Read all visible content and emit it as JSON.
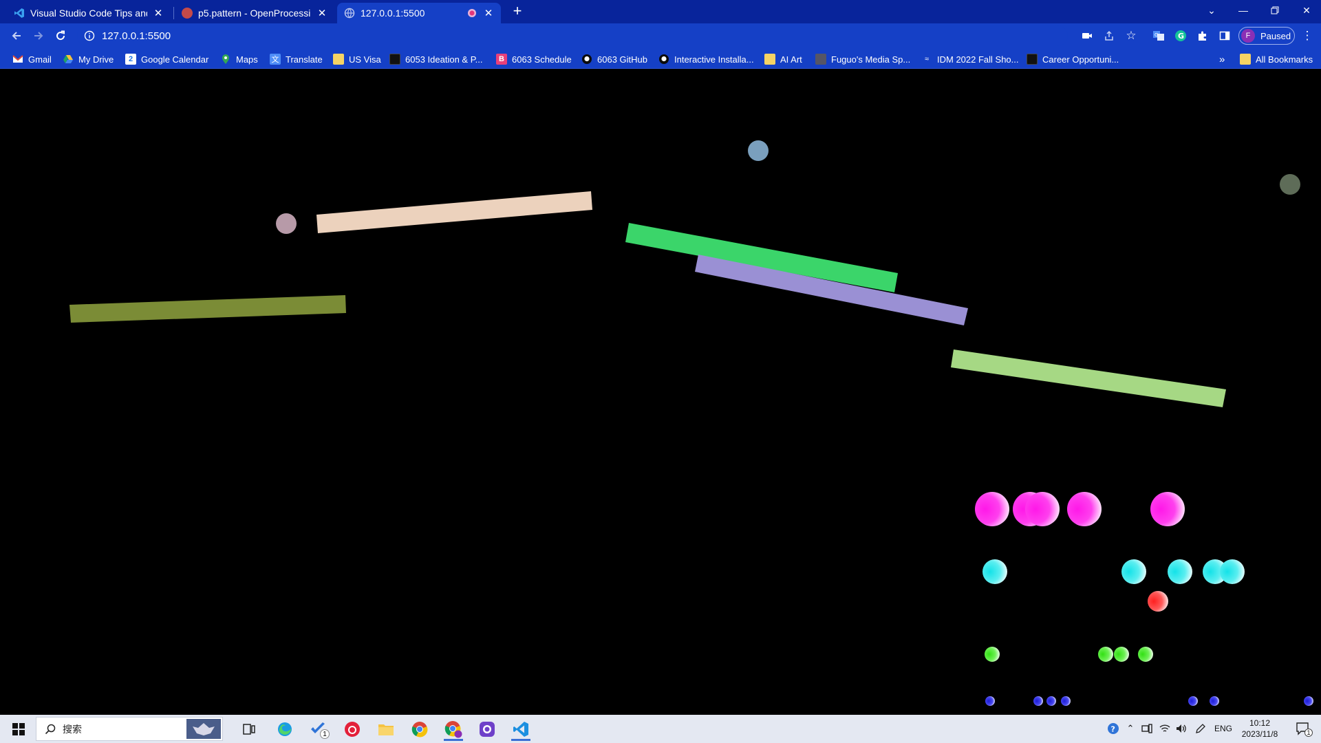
{
  "browser": {
    "tabs": [
      {
        "title": "Visual Studio Code Tips and T",
        "favicon": "vscode-icon",
        "active": false
      },
      {
        "title": "p5.pattern - OpenProcessing",
        "favicon": "openprocessing-icon",
        "active": false
      },
      {
        "title": "127.0.0.1:5500",
        "favicon": "globe-icon",
        "active": true,
        "recording": true
      }
    ],
    "new_tab": "+",
    "address": "127.0.0.1:5500",
    "profile": {
      "initial": "F",
      "status": "Paused"
    },
    "bookmarks": [
      {
        "label": "Gmail",
        "icon": "gmail-icon"
      },
      {
        "label": "My Drive",
        "icon": "drive-icon"
      },
      {
        "label": "Google Calendar",
        "icon": "calendar-icon"
      },
      {
        "label": "Maps",
        "icon": "maps-icon"
      },
      {
        "label": "Translate",
        "icon": "translate-icon"
      },
      {
        "label": "US Visa",
        "icon": "folder-icon"
      },
      {
        "label": "6053 Ideation & P...",
        "icon": "notion-icon"
      },
      {
        "label": "6063 Schedule",
        "icon": "schedule-icon"
      },
      {
        "label": "6063 GitHub",
        "icon": "github-icon"
      },
      {
        "label": "Interactive Installa...",
        "icon": "github-icon"
      },
      {
        "label": "AI Art",
        "icon": "folder-icon"
      },
      {
        "label": "Fuguo's Media Sp...",
        "icon": "cube-icon"
      },
      {
        "label": "IDM 2022 Fall Sho...",
        "icon": "idm-icon"
      },
      {
        "label": "Career Opportuni...",
        "icon": "career-icon"
      }
    ],
    "more_bookmarks": "»",
    "all_bookmarks": "All Bookmarks"
  },
  "sketch": {
    "bars": [
      {
        "color": "#ecd2bd"
      },
      {
        "color": "#3bd56a"
      },
      {
        "color": "#9a90d4"
      },
      {
        "color": "#7b8c36"
      },
      {
        "color": "#a6d884"
      }
    ],
    "floating_dots": [
      {
        "color": "#7a9fbd"
      },
      {
        "color": "#b79aa8"
      },
      {
        "color": "#5e6c58"
      }
    ],
    "ball_rows": [
      {
        "color": "#ff18e8",
        "count": 5
      },
      {
        "color": "#14e2e8",
        "count": 6
      },
      {
        "color": "#ff2020",
        "count": 1
      },
      {
        "color": "#32e014",
        "count": 5
      },
      {
        "color": "#1c1cd8",
        "count": 7
      }
    ]
  },
  "taskbar": {
    "search_placeholder": "搜索",
    "apps": [
      "widget-thumbnail",
      "task-view-icon",
      "edge-icon",
      "todo-icon",
      "netease-music-icon",
      "file-explorer-icon",
      "chrome-icon",
      "chrome-profile-icon",
      "github-desktop-icon",
      "vscode-icon"
    ],
    "todo_badge": "1",
    "language": "ENG",
    "time": "10:12",
    "date": "2023/11/8",
    "notification_count": "1"
  }
}
